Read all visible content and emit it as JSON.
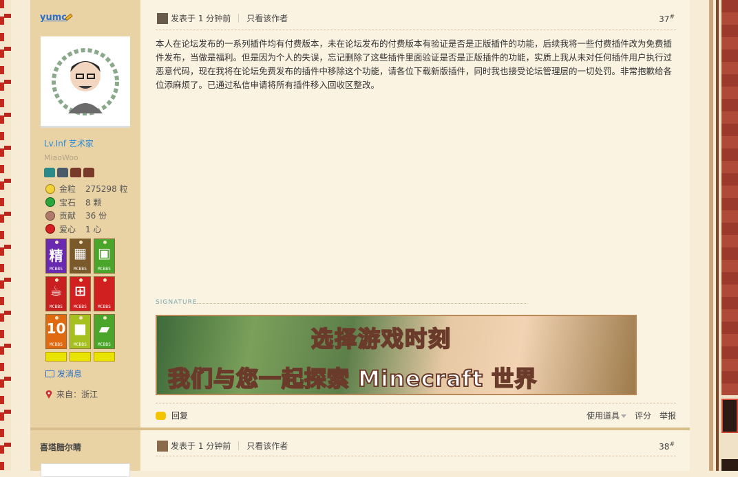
{
  "post1": {
    "author": {
      "username": "yumc",
      "level": "Lv.Inf 艺术家",
      "custom_title": "MiaoWoo",
      "stats": [
        {
          "label": "金粒",
          "value": "275298 粒",
          "color": "#f2d23a"
        },
        {
          "label": "宝石",
          "value": "8 颗",
          "color": "#2aa63a"
        },
        {
          "label": "贡献",
          "value": "36 份",
          "color": "#b07a6a"
        },
        {
          "label": "爱心",
          "value": "1 心",
          "color": "#d42020"
        }
      ],
      "badges": [
        {
          "glyph": "精",
          "color": "#6a2ab0"
        },
        {
          "glyph": "▦",
          "color": "#7a5a2a"
        },
        {
          "glyph": "▣",
          "color": "#4aa62a"
        },
        {
          "glyph": "☕",
          "color": "#c82020"
        },
        {
          "glyph": "⊞",
          "color": "#d02020"
        },
        {
          "glyph": "",
          "color": "#d02020"
        },
        {
          "glyph": "10",
          "color": "#e06a10"
        },
        {
          "glyph": "■",
          "color": "#a6c020"
        },
        {
          "glyph": "▰",
          "color": "#4aa62a"
        }
      ],
      "badge_caption": "MCBBS",
      "send_message": "发消息",
      "from_label": "来自：",
      "from_value": "浙江"
    },
    "meta": {
      "posted": "发表于 1 分钟前",
      "only_author": "只看该作者",
      "floor": "37",
      "floor_mark": "#"
    },
    "body": "本人在论坛发布的一系列插件均有付费版本，未在论坛发布的付费版本有验证是否是正版插件的功能，后续我将一些付费插件改为免费插件发布，当做是福利。但是因为个人的失误，忘记删除了这些插件里面验证是否是正版插件的功能，实质上我从未对任何插件用户执行过恶意代码，现在我将在论坛免费发布的插件中移除这个功能，请各位下载新版插件，同时我也接受论坛管理层的一切处罚。非常抱歉给各位添麻烦了。已通过私信申请将所有插件移入回收区整改。",
    "signature_label": "SIGNATURE",
    "banner": {
      "line1": "选择游戏时刻",
      "line2": "我们与您一起探索 Minecraft 世界"
    },
    "footer": {
      "reply": "回复",
      "use_tool": "使用道具",
      "rate": "评分",
      "report": "举报"
    }
  },
  "post2": {
    "author": {
      "username": "喜塔腊尔睛"
    },
    "meta": {
      "posted": "发表于 1 分钟前",
      "only_author": "只看该作者",
      "floor": "38",
      "floor_mark": "#"
    }
  }
}
